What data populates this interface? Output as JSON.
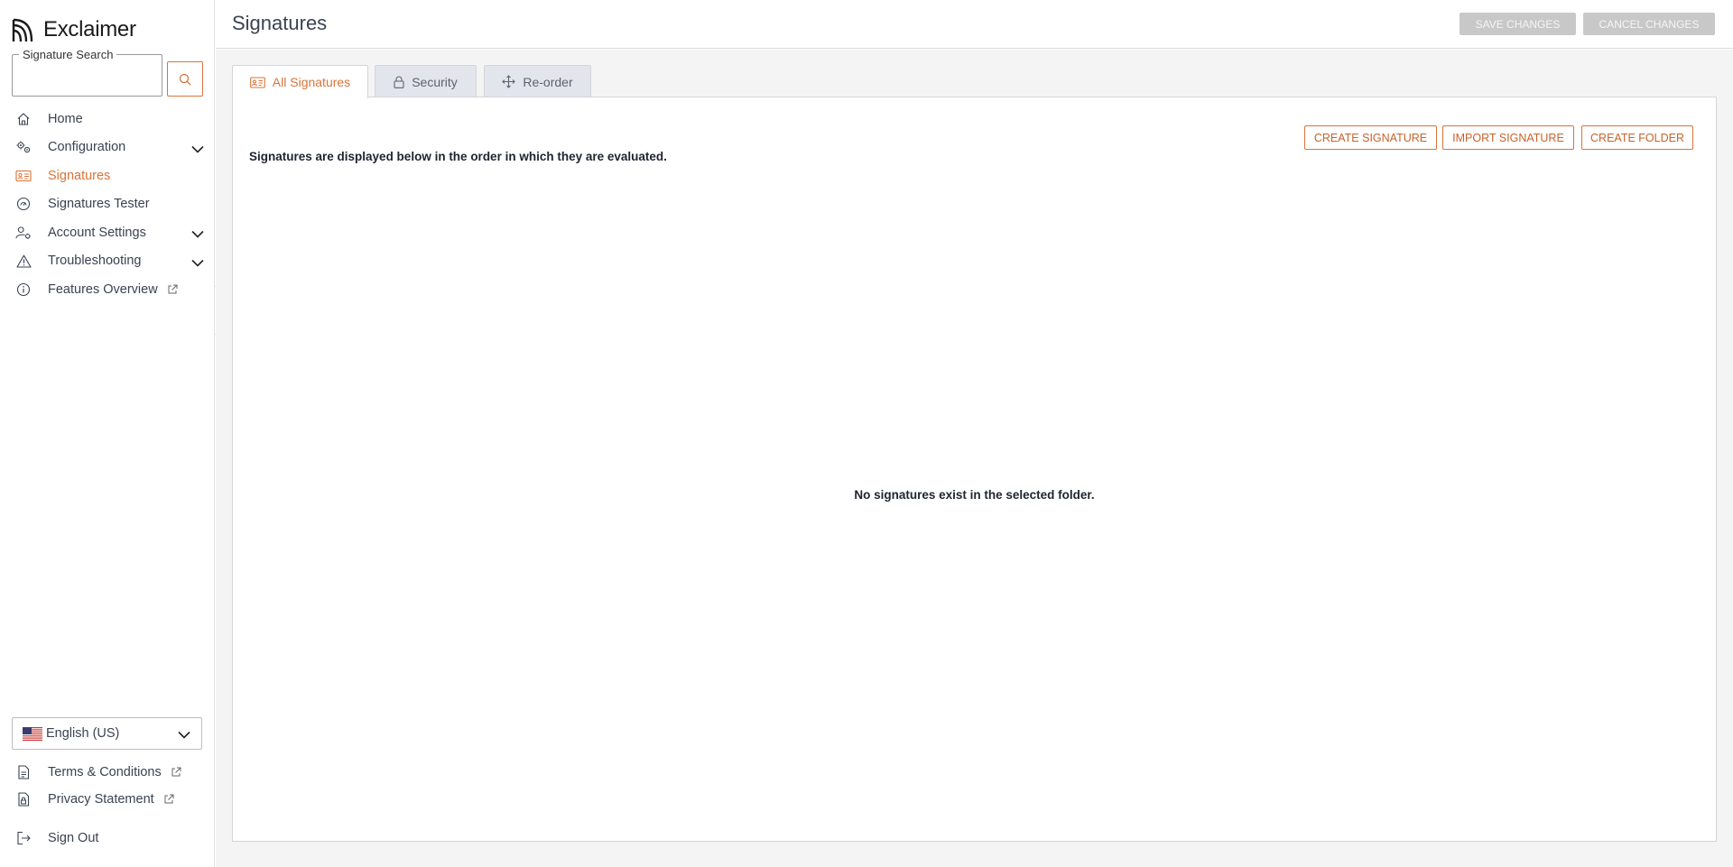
{
  "app": {
    "brand": "Exclaimer"
  },
  "sidebar": {
    "search": {
      "legend": "Signature Search",
      "value": "",
      "placeholder": ""
    },
    "items": [
      {
        "label": "Home",
        "icon": "home-icon"
      },
      {
        "label": "Configuration",
        "icon": "gears-icon",
        "expandable": true
      },
      {
        "label": "Signatures",
        "icon": "id-card-icon",
        "active": true
      },
      {
        "label": "Signatures Tester",
        "icon": "gauge-icon"
      },
      {
        "label": "Account Settings",
        "icon": "user-gear-icon",
        "expandable": true
      },
      {
        "label": "Troubleshooting",
        "icon": "warning-icon",
        "expandable": true
      },
      {
        "label": "Features Overview",
        "icon": "info-icon",
        "external": true
      }
    ],
    "language": {
      "selected": "English (US)"
    },
    "bottom_items": [
      {
        "label": "Terms & Conditions",
        "icon": "document-icon",
        "external": true
      },
      {
        "label": "Privacy Statement",
        "icon": "document-lock-icon",
        "external": true
      },
      {
        "label": "Sign Out",
        "icon": "sign-out-icon"
      }
    ]
  },
  "header": {
    "title": "Signatures",
    "save_label": "SAVE CHANGES",
    "cancel_label": "CANCEL CHANGES"
  },
  "tabs": [
    {
      "label": "All Signatures",
      "icon": "id-card-icon",
      "active": true
    },
    {
      "label": "Security",
      "icon": "lock-icon"
    },
    {
      "label": "Re-order",
      "icon": "move-icon"
    }
  ],
  "panel": {
    "note": "Signatures are displayed below in the order in which they are evaluated.",
    "create_signature": "CREATE SIGNATURE",
    "import_signature": "IMPORT SIGNATURE",
    "create_folder": "CREATE FOLDER",
    "empty_message": "No signatures exist in the selected folder."
  },
  "colors": {
    "accent": "#d9733a",
    "disabled_button": "#c8c8c8",
    "tab_inactive": "#e3e5ec",
    "content_background": "#f4f4f5"
  }
}
